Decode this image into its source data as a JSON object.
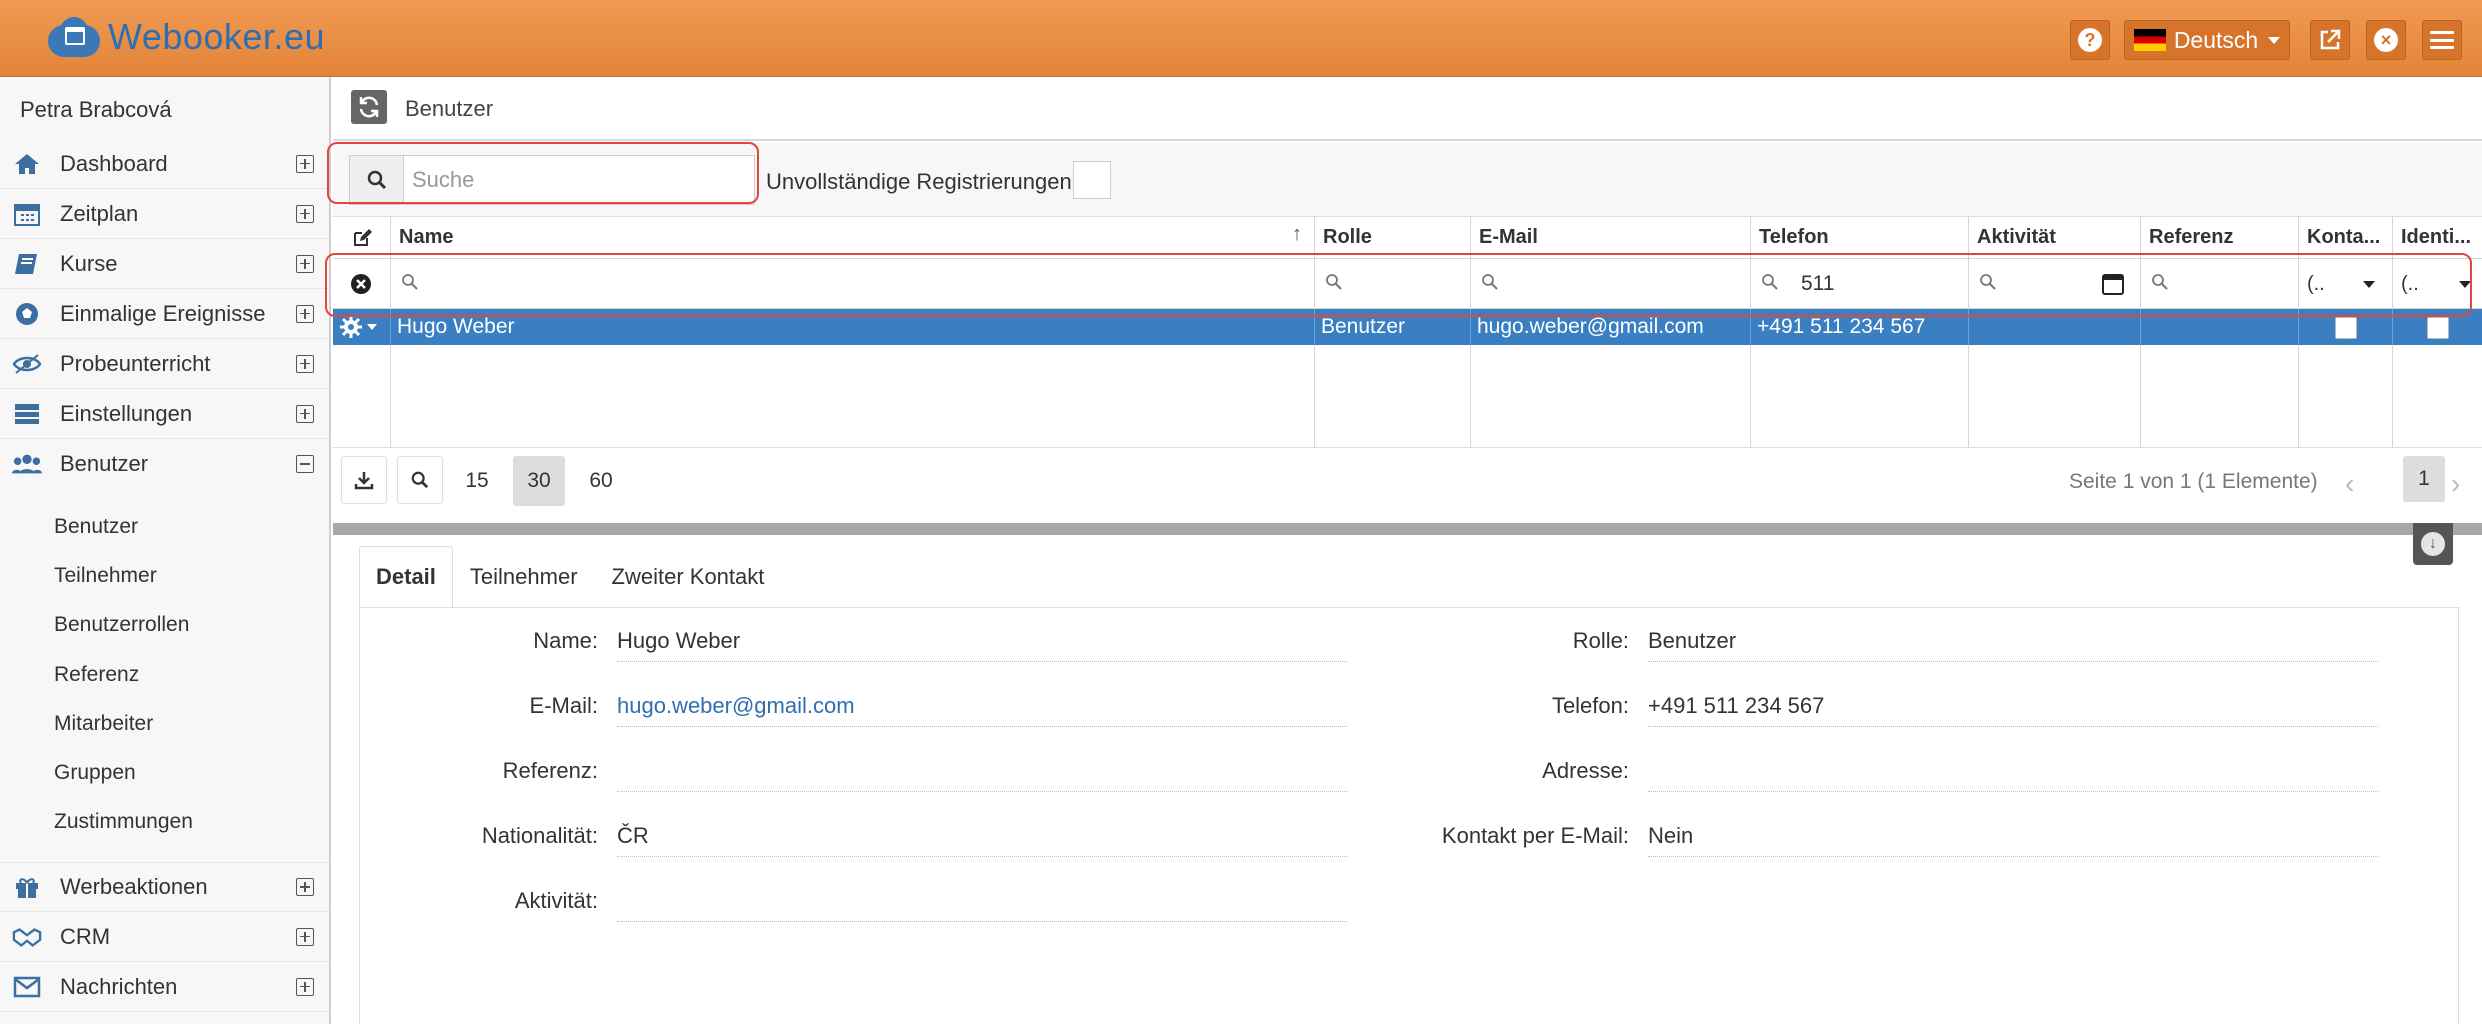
{
  "app": {
    "logo_text": "Webooker.eu",
    "language": "Deutsch",
    "help_symbol": "?",
    "close_symbol": "×"
  },
  "sidebar": {
    "user": "Petra Brabcová",
    "items": [
      {
        "label": "Dashboard",
        "icon": "home-icon"
      },
      {
        "label": "Zeitplan",
        "icon": "calendar-icon"
      },
      {
        "label": "Kurse",
        "icon": "book-icon"
      },
      {
        "label": "Einmalige Ereignisse",
        "icon": "ball-icon"
      },
      {
        "label": "Probeunterricht",
        "icon": "eye-icon"
      },
      {
        "label": "Einstellungen",
        "icon": "settings-icon"
      },
      {
        "label": "Benutzer",
        "icon": "users-icon"
      },
      {
        "label": "Werbeaktionen",
        "icon": "gift-icon"
      },
      {
        "label": "CRM",
        "icon": "handshake-icon"
      },
      {
        "label": "Nachrichten",
        "icon": "envelope-icon"
      }
    ],
    "subitems": [
      "Benutzer",
      "Teilnehmer",
      "Benutzerrollen",
      "Referenz",
      "Mitarbeiter",
      "Gruppen",
      "Zustimmungen"
    ]
  },
  "page": {
    "title": "Benutzer"
  },
  "toolbar": {
    "search_placeholder": "Suche",
    "incomplete_label": "Unvollständige Registrierungen:"
  },
  "grid": {
    "columns": [
      "Name",
      "Rolle",
      "E-Mail",
      "Telefon",
      "Aktivität",
      "Referenz",
      "Konta...",
      "Identi..."
    ],
    "filters": {
      "telefon": "511",
      "konta": "(..",
      "identi": "(.."
    },
    "rows": [
      {
        "name": "Hugo Weber",
        "rolle": "Benutzer",
        "email": "hugo.weber@gmail.com",
        "telefon": "+491 511 234 567"
      }
    ],
    "page_sizes": [
      "15",
      "30",
      "60"
    ],
    "active_page_size": "30",
    "page_info": "Seite 1 von 1 (1 Elemente)",
    "current_page": "1"
  },
  "detail": {
    "tabs": [
      "Detail",
      "Teilnehmer",
      "Zweiter Kontakt"
    ],
    "fields": {
      "name_label": "Name:",
      "name": "Hugo Weber",
      "email_label": "E-Mail:",
      "email": "hugo.weber@gmail.com",
      "referenz_label": "Referenz:",
      "referenz": "",
      "nationalitaet_label": "Nationalität:",
      "nationalitaet": "ČR",
      "aktivitaet_label": "Aktivität:",
      "aktivitaet": "",
      "rolle_label": "Rolle:",
      "rolle": "Benutzer",
      "telefon_label": "Telefon:",
      "telefon": "+491 511 234 567",
      "adresse_label": "Adresse:",
      "adresse": "",
      "kontakt_label": "Kontakt per E-Mail:",
      "kontakt": "Nein"
    }
  },
  "colors": {
    "header": "#e88b41",
    "accent": "#3a7fc1",
    "highlight": "#e0483d"
  }
}
